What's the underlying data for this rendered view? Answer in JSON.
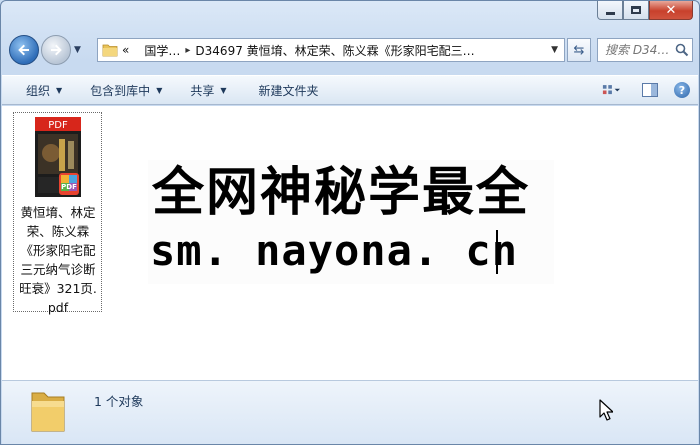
{
  "window": {
    "caption": {
      "minimize": "minimize",
      "maximize": "maximize",
      "close": "close"
    }
  },
  "nav": {
    "breadcrumb_overflow": "«",
    "crumbs": [
      "国学…",
      "D34697 黄恒堉、林定荣、陈义霖《形家阳宅配三…"
    ],
    "search_placeholder": "搜索 D34…"
  },
  "toolbar": {
    "items": [
      {
        "label": "组织",
        "has_menu": true
      },
      {
        "label": "包含到库中",
        "has_menu": true
      },
      {
        "label": "共享",
        "has_menu": true
      },
      {
        "label": "新建文件夹",
        "has_menu": false
      }
    ],
    "help": "?"
  },
  "file": {
    "thumb_badge": "PDF",
    "name": "黄恒堉、林定荣、陈义霖《形家阳宅配三元纳气诊断旺衰》321页.pdf"
  },
  "watermark": {
    "line1": "全网神秘学最全",
    "line2": "sm. nayona. cn"
  },
  "details": {
    "count": "1 个对象"
  },
  "colors": {
    "accent": "#1e395b",
    "close_red": "#c8412c",
    "pdf_red": "#d7261b"
  }
}
